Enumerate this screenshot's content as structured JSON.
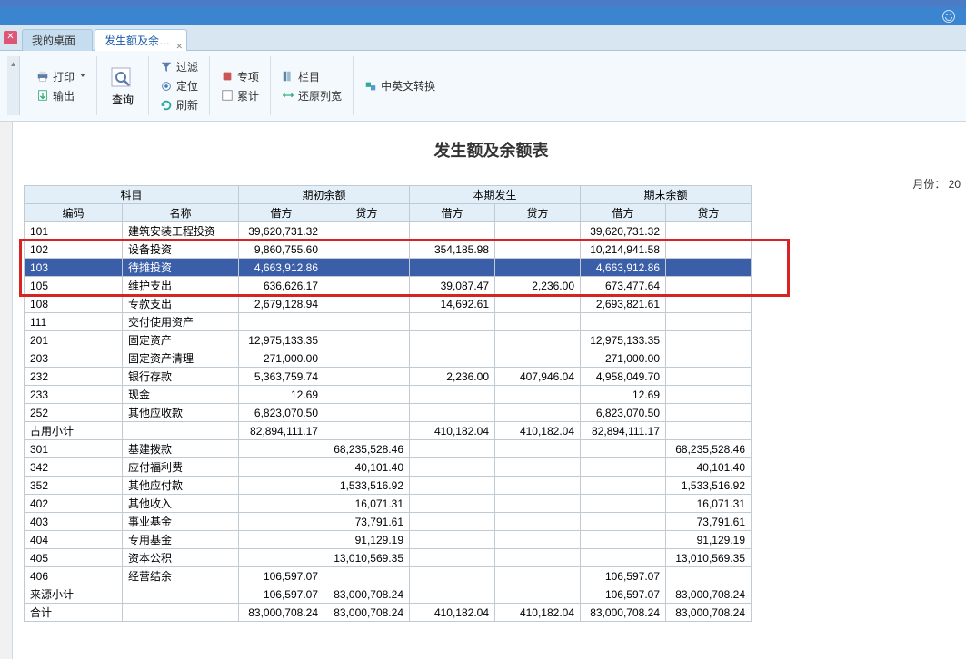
{
  "tabs": {
    "desktop": "我的桌面",
    "report": "发生额及余…"
  },
  "ribbon": {
    "print": "打印",
    "export": "输出",
    "query": "查询",
    "filter": "过滤",
    "locate": "定位",
    "refresh": "刷新",
    "special": "专项",
    "accum": "累计",
    "column": "栏目",
    "restore": "还原列宽",
    "lang": "中英文转换"
  },
  "report": {
    "title": "发生额及余额表",
    "month_label": "月份： 20"
  },
  "headers": {
    "subject": "科目",
    "open_bal": "期初余额",
    "current": "本期发生",
    "close_bal": "期末余额",
    "code": "编码",
    "name": "名称",
    "debit": "借方",
    "credit": "贷方"
  },
  "rows": [
    {
      "code": "101",
      "name": "建筑安装工程投资",
      "od": "39,620,731.32",
      "oc": "",
      "cd": "",
      "cc": "",
      "ed": "39,620,731.32",
      "ec": ""
    },
    {
      "code": "102",
      "name": "设备投资",
      "od": "9,860,755.60",
      "oc": "",
      "cd": "354,185.98",
      "cc": "",
      "ed": "10,214,941.58",
      "ec": ""
    },
    {
      "code": "103",
      "name": "待摊投资",
      "od": "4,663,912.86",
      "oc": "",
      "cd": "",
      "cc": "",
      "ed": "4,663,912.86",
      "ec": "",
      "sel": true
    },
    {
      "code": "105",
      "name": "维护支出",
      "od": "636,626.17",
      "oc": "",
      "cd": "39,087.47",
      "cc": "2,236.00",
      "ed": "673,477.64",
      "ec": ""
    },
    {
      "code": "108",
      "name": "专款支出",
      "od": "2,679,128.94",
      "oc": "",
      "cd": "14,692.61",
      "cc": "",
      "ed": "2,693,821.61",
      "ec": ""
    },
    {
      "code": "111",
      "name": "交付使用资产",
      "od": "",
      "oc": "",
      "cd": "",
      "cc": "",
      "ed": "",
      "ec": ""
    },
    {
      "code": "201",
      "name": "固定资产",
      "od": "12,975,133.35",
      "oc": "",
      "cd": "",
      "cc": "",
      "ed": "12,975,133.35",
      "ec": ""
    },
    {
      "code": "203",
      "name": "固定资产清理",
      "od": "271,000.00",
      "oc": "",
      "cd": "",
      "cc": "",
      "ed": "271,000.00",
      "ec": ""
    },
    {
      "code": "232",
      "name": "银行存款",
      "od": "5,363,759.74",
      "oc": "",
      "cd": "2,236.00",
      "cc": "407,946.04",
      "ed": "4,958,049.70",
      "ec": ""
    },
    {
      "code": "233",
      "name": "现金",
      "od": "12.69",
      "oc": "",
      "cd": "",
      "cc": "",
      "ed": "12.69",
      "ec": ""
    },
    {
      "code": "252",
      "name": "其他应收款",
      "od": "6,823,070.50",
      "oc": "",
      "cd": "",
      "cc": "",
      "ed": "6,823,070.50",
      "ec": ""
    },
    {
      "code": "占用小计",
      "name": "",
      "od": "82,894,111.17",
      "oc": "",
      "cd": "410,182.04",
      "cc": "410,182.04",
      "ed": "82,894,111.17",
      "ec": ""
    },
    {
      "code": "301",
      "name": "基建拨款",
      "od": "",
      "oc": "68,235,528.46",
      "cd": "",
      "cc": "",
      "ed": "",
      "ec": "68,235,528.46"
    },
    {
      "code": "342",
      "name": "应付福利费",
      "od": "",
      "oc": "40,101.40",
      "cd": "",
      "cc": "",
      "ed": "",
      "ec": "40,101.40"
    },
    {
      "code": "352",
      "name": "其他应付款",
      "od": "",
      "oc": "1,533,516.92",
      "cd": "",
      "cc": "",
      "ed": "",
      "ec": "1,533,516.92"
    },
    {
      "code": "402",
      "name": "其他收入",
      "od": "",
      "oc": "16,071.31",
      "cd": "",
      "cc": "",
      "ed": "",
      "ec": "16,071.31"
    },
    {
      "code": "403",
      "name": "事业基金",
      "od": "",
      "oc": "73,791.61",
      "cd": "",
      "cc": "",
      "ed": "",
      "ec": "73,791.61"
    },
    {
      "code": "404",
      "name": "专用基金",
      "od": "",
      "oc": "91,129.19",
      "cd": "",
      "cc": "",
      "ed": "",
      "ec": "91,129.19"
    },
    {
      "code": "405",
      "name": "资本公积",
      "od": "",
      "oc": "13,010,569.35",
      "cd": "",
      "cc": "",
      "ed": "",
      "ec": "13,010,569.35"
    },
    {
      "code": "406",
      "name": "经营结余",
      "od": "106,597.07",
      "oc": "",
      "cd": "",
      "cc": "",
      "ed": "106,597.07",
      "ec": ""
    },
    {
      "code": "来源小计",
      "name": "",
      "od": "106,597.07",
      "oc": "83,000,708.24",
      "cd": "",
      "cc": "",
      "ed": "106,597.07",
      "ec": "83,000,708.24"
    },
    {
      "code": "合计",
      "name": "",
      "od": "83,000,708.24",
      "oc": "83,000,708.24",
      "cd": "410,182.04",
      "cc": "410,182.04",
      "ed": "83,000,708.24",
      "ec": "83,000,708.24"
    }
  ]
}
